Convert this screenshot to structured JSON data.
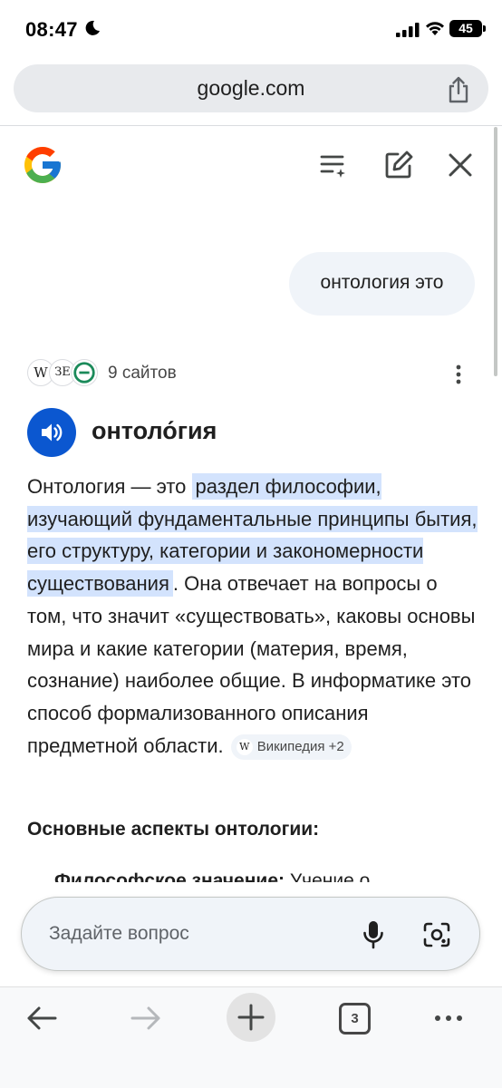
{
  "status_bar": {
    "time": "08:47",
    "battery": "45"
  },
  "browser": {
    "url": "google.com"
  },
  "ai_chat": {
    "query": "онтология это",
    "sources": {
      "icons": [
        "wikipedia-icon",
        "site-icon",
        "site-e-icon"
      ],
      "label": "9 сайтов"
    },
    "headword": "онтоло́гия",
    "paragraph": {
      "before": "Онтология — это ",
      "highlight": "раздел философии, изучающий фундаментальные принципы бытия, его структуру, категории и закономерности существования",
      "after": ". Она отвечает на вопросы о том, что значит «существовать», каковы основы мира и какие категории (материя, время, сознание) наиболее общие. В информатике это способ формализованного описания предметной области.",
      "citation": "Википедия +2"
    },
    "section_title": "Основные аспекты онтологии:",
    "cut_item": {
      "bold": "Философское значение:",
      "text": " Учение о"
    }
  },
  "ask": {
    "placeholder": "Задайте вопрос"
  },
  "toolbar": {
    "tab_count": "3"
  },
  "colors": {
    "accent": "#0b57d0",
    "highlight": "#d3e3fd",
    "bubble": "#f0f4f9",
    "url_bar": "#e8eaed"
  }
}
